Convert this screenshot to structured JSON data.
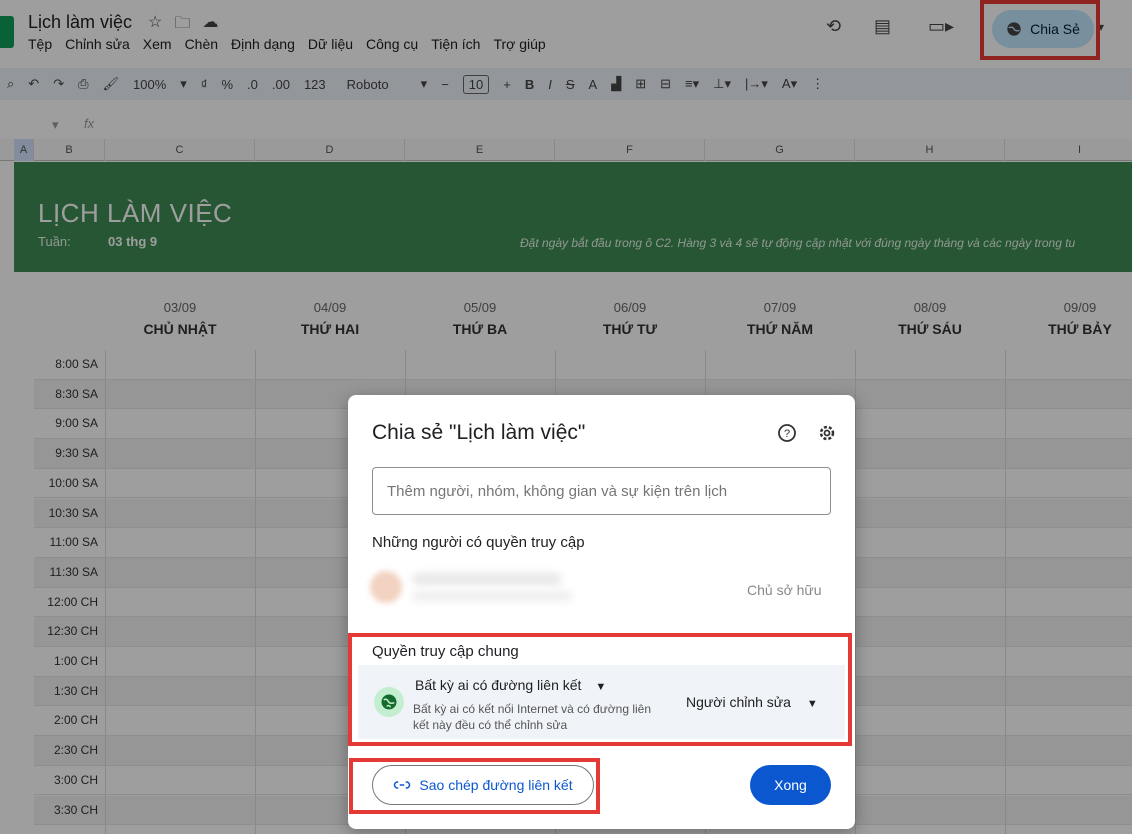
{
  "app": {
    "doc_title": "Lịch làm việc",
    "menu": [
      "Tệp",
      "Chỉnh sửa",
      "Xem",
      "Chèn",
      "Định dạng",
      "Dữ liệu",
      "Công cụ",
      "Tiện ích",
      "Trợ giúp"
    ],
    "share_label": "Chia Sẻ"
  },
  "toolbar": {
    "zoom": "100%",
    "currency": "₫",
    "percent": "%",
    "dec_less": ".0",
    "dec_more": ".00",
    "format_123": "123",
    "font": "Roboto",
    "font_size": "10",
    "bold": "B",
    "italic": "I",
    "strike": "S",
    "text_color": "A"
  },
  "formula": {
    "fx": "fx"
  },
  "columns": [
    "A",
    "B",
    "C",
    "D",
    "E",
    "F",
    "G",
    "H",
    "I"
  ],
  "sheet": {
    "banner_title": "LỊCH LÀM VIỆC",
    "week_label": "Tuần:",
    "week_value": "03 thg 9",
    "note": "Đặt ngày bắt đầu trong ô C2. Hàng 3 và 4 sẽ tự động cập nhật với đúng ngày tháng và các ngày trong tu",
    "days": [
      {
        "date": "03/09",
        "name": "CHỦ NHẬT"
      },
      {
        "date": "04/09",
        "name": "THỨ HAI"
      },
      {
        "date": "05/09",
        "name": "THỨ BA"
      },
      {
        "date": "06/09",
        "name": "THỨ TƯ"
      },
      {
        "date": "07/09",
        "name": "THỨ NĂM"
      },
      {
        "date": "08/09",
        "name": "THỨ SÁU"
      },
      {
        "date": "09/09",
        "name": "THỨ BẢY"
      }
    ],
    "times": [
      "8:00 SA",
      "8:30 SA",
      "9:00 SA",
      "9:30 SA",
      "10:00 SA",
      "10:30 SA",
      "11:00 SA",
      "11:30 SA",
      "12:00 CH",
      "12:30 CH",
      "1:00 CH",
      "1:30 CH",
      "2:00 CH",
      "2:30 CH",
      "3:00 CH",
      "3:30 CH"
    ]
  },
  "dialog": {
    "title": "Chia sẻ \"Lịch làm việc\"",
    "input_placeholder": "Thêm người, nhóm, không gian và sự kiện trên lịch",
    "people_heading": "Những người có quyền truy cập",
    "owner_role": "Chủ sở hữu",
    "general_access_heading": "Quyền truy cập chung",
    "access_option": "Bất kỳ ai có đường liên kết",
    "access_description": "Bất kỳ ai có kết nối Internet và có đường liên kết này đều có thể chỉnh sửa",
    "role_option": "Người chỉnh sửa",
    "copy_link_label": "Sao chép đường liên kết",
    "done_label": "Xong"
  },
  "colors": {
    "banner": "#3f8c55",
    "share_button": "#c2e7ff",
    "primary": "#0b57d0",
    "highlight_box": "#e53935"
  }
}
